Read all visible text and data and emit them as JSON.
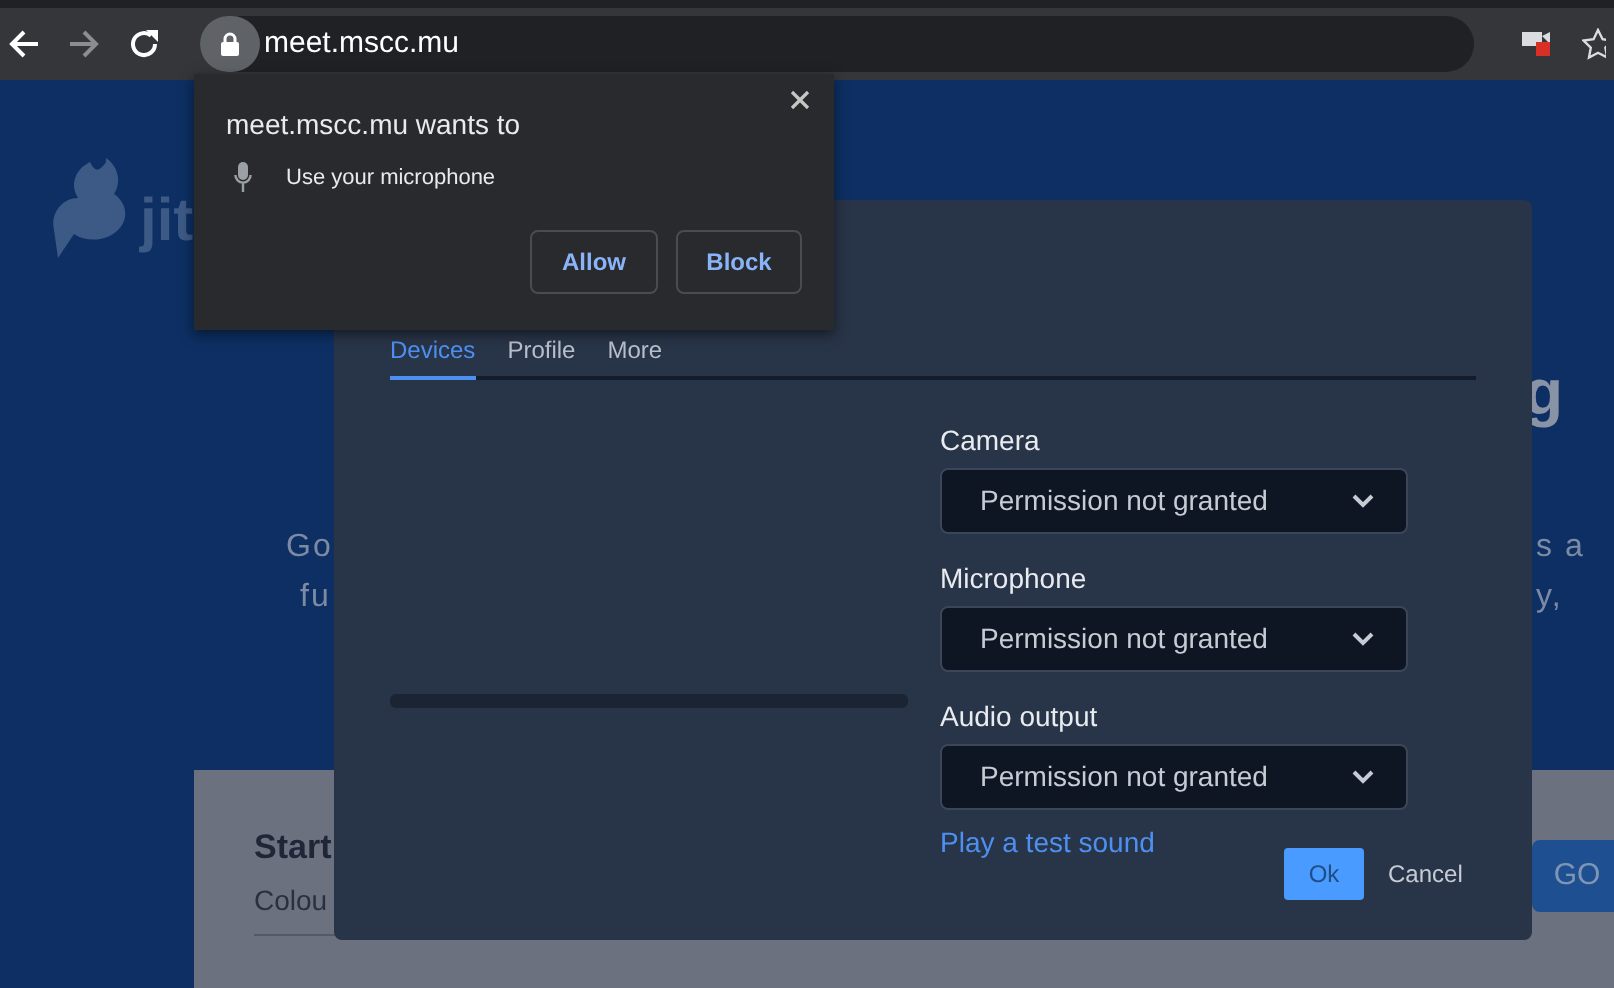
{
  "browser": {
    "url": "meet.mscc.mu"
  },
  "background_page": {
    "logo_text": "jit",
    "heading_fragments": [
      "g"
    ],
    "text_fragments": [
      "Go",
      "fu",
      "s a",
      "y,"
    ],
    "card": {
      "title": "Start",
      "input_value": "Colou",
      "button": "GO"
    }
  },
  "settings_dialog": {
    "tabs": [
      {
        "label": "Devices",
        "selected": true
      },
      {
        "label": "Profile",
        "selected": false
      },
      {
        "label": "More",
        "selected": false
      }
    ],
    "devices": [
      {
        "label": "Camera",
        "value": "Permission not granted"
      },
      {
        "label": "Microphone",
        "value": "Permission not granted"
      },
      {
        "label": "Audio output",
        "value": "Permission not granted"
      }
    ],
    "test_link": "Play a test sound",
    "buttons": [
      {
        "label": "Ok",
        "kind": "primary"
      },
      {
        "label": "Cancel",
        "kind": "secondary"
      }
    ]
  },
  "permission_popup": {
    "title": "meet.mscc.mu wants to",
    "request": "Use your microphone",
    "buttons": [
      "Allow",
      "Block"
    ]
  }
}
